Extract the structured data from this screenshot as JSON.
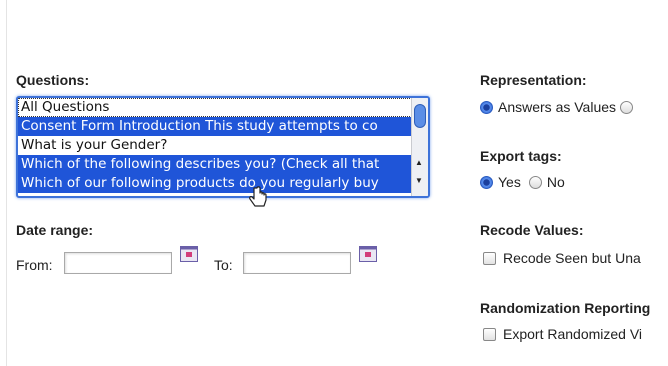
{
  "questions": {
    "label": "Questions:",
    "items": [
      {
        "text": "All Questions",
        "selected": false
      },
      {
        "text": "Consent Form Introduction This study attempts to co",
        "selected": true
      },
      {
        "text": "What is your Gender?",
        "selected": false
      },
      {
        "text": "Which of the following describes you? (Check all that",
        "selected": true
      },
      {
        "text": "Which of our following products do you regularly buy",
        "selected": true
      }
    ]
  },
  "date_range": {
    "label": "Date range:",
    "from_label": "From:",
    "to_label": "To:",
    "from_value": "",
    "to_value": ""
  },
  "representation": {
    "label": "Representation:",
    "option_values": "Answers as Values"
  },
  "export_tags": {
    "label": "Export tags:",
    "yes": "Yes",
    "no": "No",
    "selected": "Yes"
  },
  "recode_values": {
    "label": "Recode Values:",
    "option": "Recode Seen but Una"
  },
  "randomization": {
    "label": "Randomization Reporting",
    "option": "Export Randomized Vi"
  },
  "colors": {
    "selection": "#1f55d8",
    "focus_border": "#3d72d9"
  }
}
